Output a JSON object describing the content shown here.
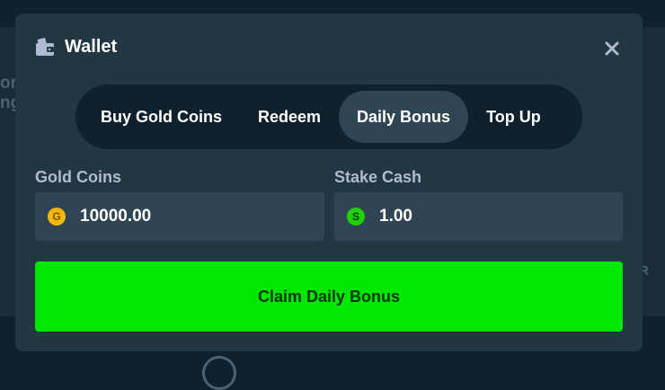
{
  "background": {
    "fragment_left_1": "or",
    "fragment_left_2": "ng",
    "fragment_right": "R"
  },
  "modal": {
    "title": "Wallet",
    "icons": {
      "title_icon": "wallet-icon",
      "close": "close-icon"
    },
    "tabs": [
      {
        "label": "Buy Gold Coins",
        "active": false
      },
      {
        "label": "Redeem",
        "active": false
      },
      {
        "label": "Daily Bonus",
        "active": true
      },
      {
        "label": "Top Up",
        "active": false
      }
    ],
    "balances": {
      "gold": {
        "label": "Gold Coins",
        "icon_letter": "G",
        "value": "10000.00",
        "color": "#f5b80a"
      },
      "stake_cash": {
        "label": "Stake Cash",
        "icon_letter": "S",
        "value": "1.00",
        "color": "#1fd00a"
      }
    },
    "claim_button": {
      "label": "Claim Daily Bonus",
      "color": "#00e701"
    }
  },
  "colors": {
    "page_bg": "#0f212e",
    "modal_bg": "#213743",
    "field_bg": "#2f4553",
    "text_muted": "#b1bad3"
  }
}
